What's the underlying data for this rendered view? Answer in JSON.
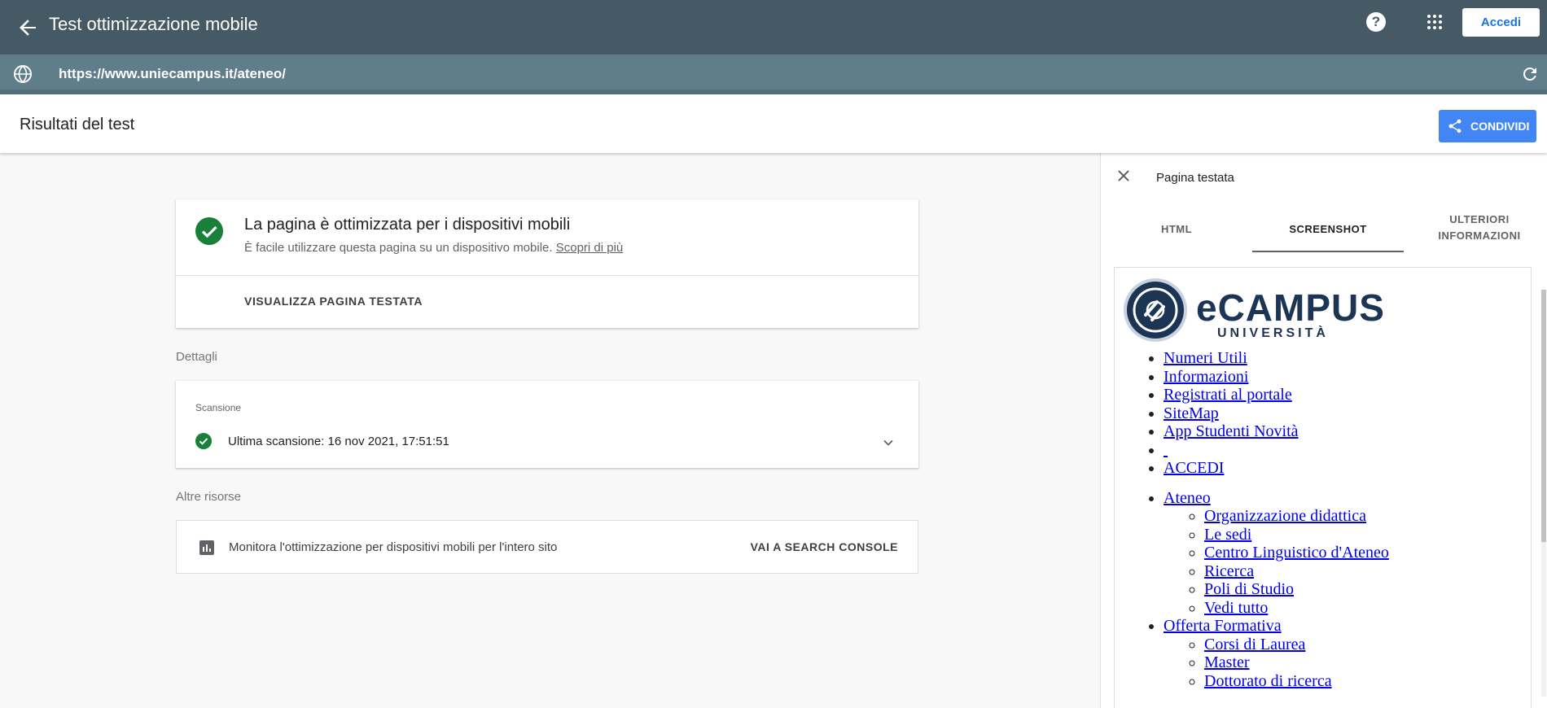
{
  "topbar": {
    "title": "Test ottimizzazione mobile",
    "help_label": "?",
    "signin_label": "Accedi"
  },
  "urlbar": {
    "url": "https://www.uniecampus.it/ateneo/"
  },
  "header": {
    "title": "Risultati del test",
    "share_label": "CONDIVIDI"
  },
  "result": {
    "headline": "La pagina è ottimizzata per i dispositivi mobili",
    "subtext": "È facile utilizzare questa pagina su un dispositivo mobile.",
    "learn_more": "Scopri di più",
    "view_page": "VISUALIZZA PAGINA TESTATA"
  },
  "details": {
    "section_label": "Dettagli",
    "crawl_label": "Scansione",
    "last_crawl": "Ultima scansione: 16 nov 2021, 17:51:51"
  },
  "resources": {
    "section_label": "Altre risorse",
    "monitor_text": "Monitora l'ottimizzazione per dispositivi mobili per l'intero sito",
    "console_link": "VAI A SEARCH CONSOLE"
  },
  "panel": {
    "title": "Pagina testata",
    "tabs": [
      {
        "label": "HTML",
        "active": false
      },
      {
        "label": "SCREENSHOT",
        "active": true
      },
      {
        "label_line1": "ULTERIORI",
        "label_line2": "INFORMAZIONI",
        "active": false
      }
    ],
    "screenshot": {
      "logo_brand": "eCAMPUS",
      "logo_sub": "UNIVERSITÀ",
      "menu_top": [
        "Numeri Utili",
        "Informazioni",
        "Registrati al portale",
        "SiteMap",
        "App Studenti Novità",
        "",
        "ACCEDI"
      ],
      "ateneo": {
        "label": "Ateneo",
        "items": [
          "Organizzazione didattica",
          "Le sedi",
          "Centro Linguistico d'Ateneo",
          "Ricerca",
          "Poli di Studio",
          "Vedi tutto"
        ]
      },
      "offerta": {
        "label": "Offerta Formativa",
        "items": [
          "Corsi di Laurea",
          "Master",
          "Dottorato di ricerca"
        ]
      }
    }
  },
  "colors": {
    "topbar": "#455a64",
    "urlbar": "#607d8b",
    "success_green": "#188038",
    "share_blue": "#4285f4",
    "link_blue": "#0000ee"
  }
}
